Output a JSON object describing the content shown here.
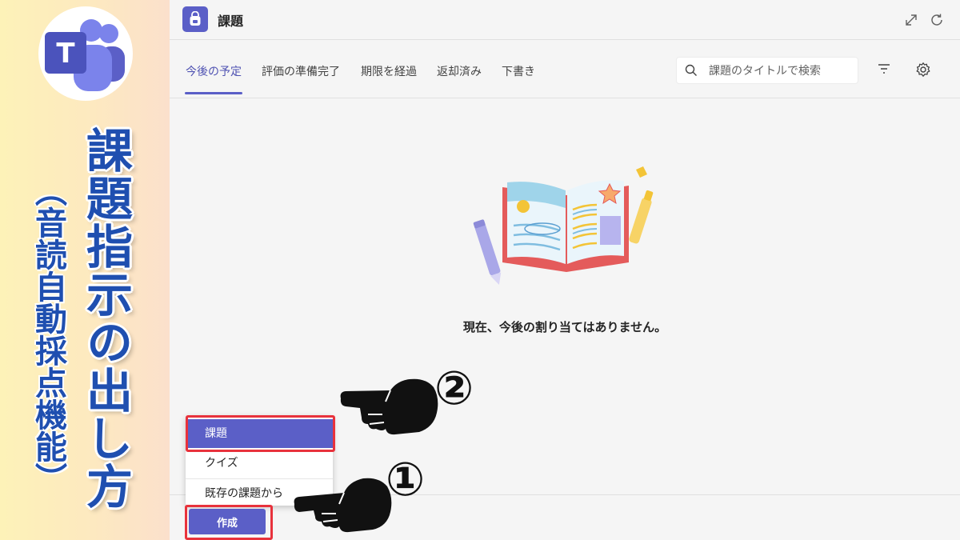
{
  "banner": {
    "title": "課題指示の出し方",
    "subtitle": "（音読自動採点機能）",
    "logo_letter": "T"
  },
  "topbar": {
    "title": "課題",
    "icons": [
      "expand-icon",
      "refresh-icon"
    ]
  },
  "tabs": [
    {
      "label": "今後の予定",
      "active": true
    },
    {
      "label": "評価の準備完了",
      "active": false
    },
    {
      "label": "期限を経過",
      "active": false
    },
    {
      "label": "返却済み",
      "active": false
    },
    {
      "label": "下書き",
      "active": false
    }
  ],
  "search": {
    "placeholder": "課題のタイトルで検索"
  },
  "empty_message": "現在、今後の割り当てはありません。",
  "menu": {
    "items": [
      {
        "label": "課題",
        "selected": true
      },
      {
        "label": "クイズ",
        "selected": false
      },
      {
        "label": "既存の課題から",
        "selected": false
      }
    ]
  },
  "create_button": {
    "label": "作成"
  },
  "annotations": {
    "step1": "①",
    "step2": "②",
    "highlight_color": "#e8323c"
  },
  "colors": {
    "accent": "#5b5fc7",
    "banner_text": "#1f4fb0"
  }
}
